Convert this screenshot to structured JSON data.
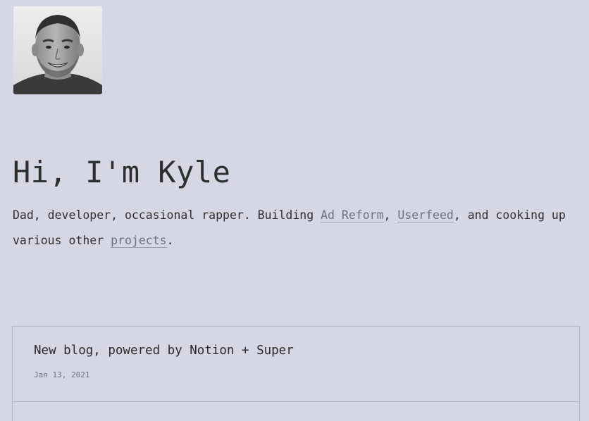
{
  "profile": {
    "avatar_icon": "person-photo-icon"
  },
  "hero": {
    "title": "Hi, I'm Kyle",
    "intro_prefix": "Dad, developer, occasional rapper. Building ",
    "link_ad_reform": "Ad Reform",
    "sep_comma": ", ",
    "link_userfeed": "Userfeed",
    "intro_middle": ", and cooking up various other ",
    "link_projects": "projects",
    "intro_end": "."
  },
  "posts": [
    {
      "title": "New blog, powered by Notion + Super",
      "date": "Jan 13, 2021"
    }
  ],
  "colors": {
    "background": "#d5d8e4",
    "text": "#2e2e2e",
    "link": "#6c7083",
    "border": "#b4b8c6"
  }
}
